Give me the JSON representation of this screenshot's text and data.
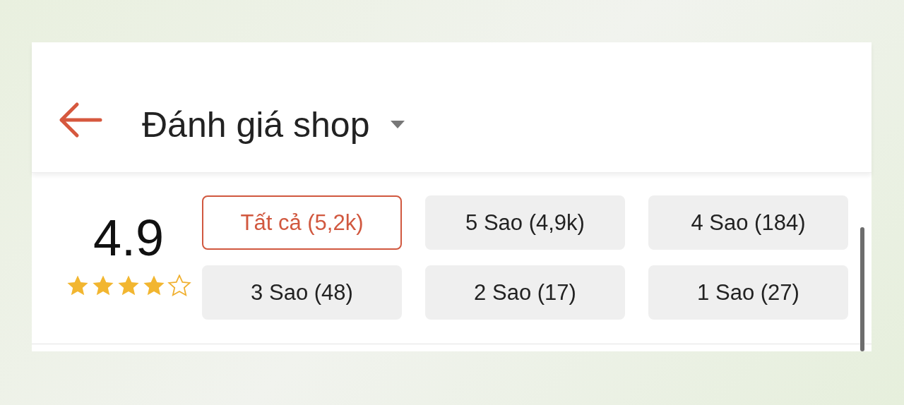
{
  "header": {
    "title": "Đánh giá shop"
  },
  "summary": {
    "score": "4.9",
    "stars": 4
  },
  "filters": [
    {
      "label": "Tất cả (5,2k)",
      "selected": true
    },
    {
      "label": "5 Sao (4,9k)",
      "selected": false
    },
    {
      "label": "4 Sao (184)",
      "selected": false
    },
    {
      "label": "3 Sao (48)",
      "selected": false
    },
    {
      "label": "2 Sao (17)",
      "selected": false
    },
    {
      "label": "1 Sao (27)",
      "selected": false
    }
  ]
}
